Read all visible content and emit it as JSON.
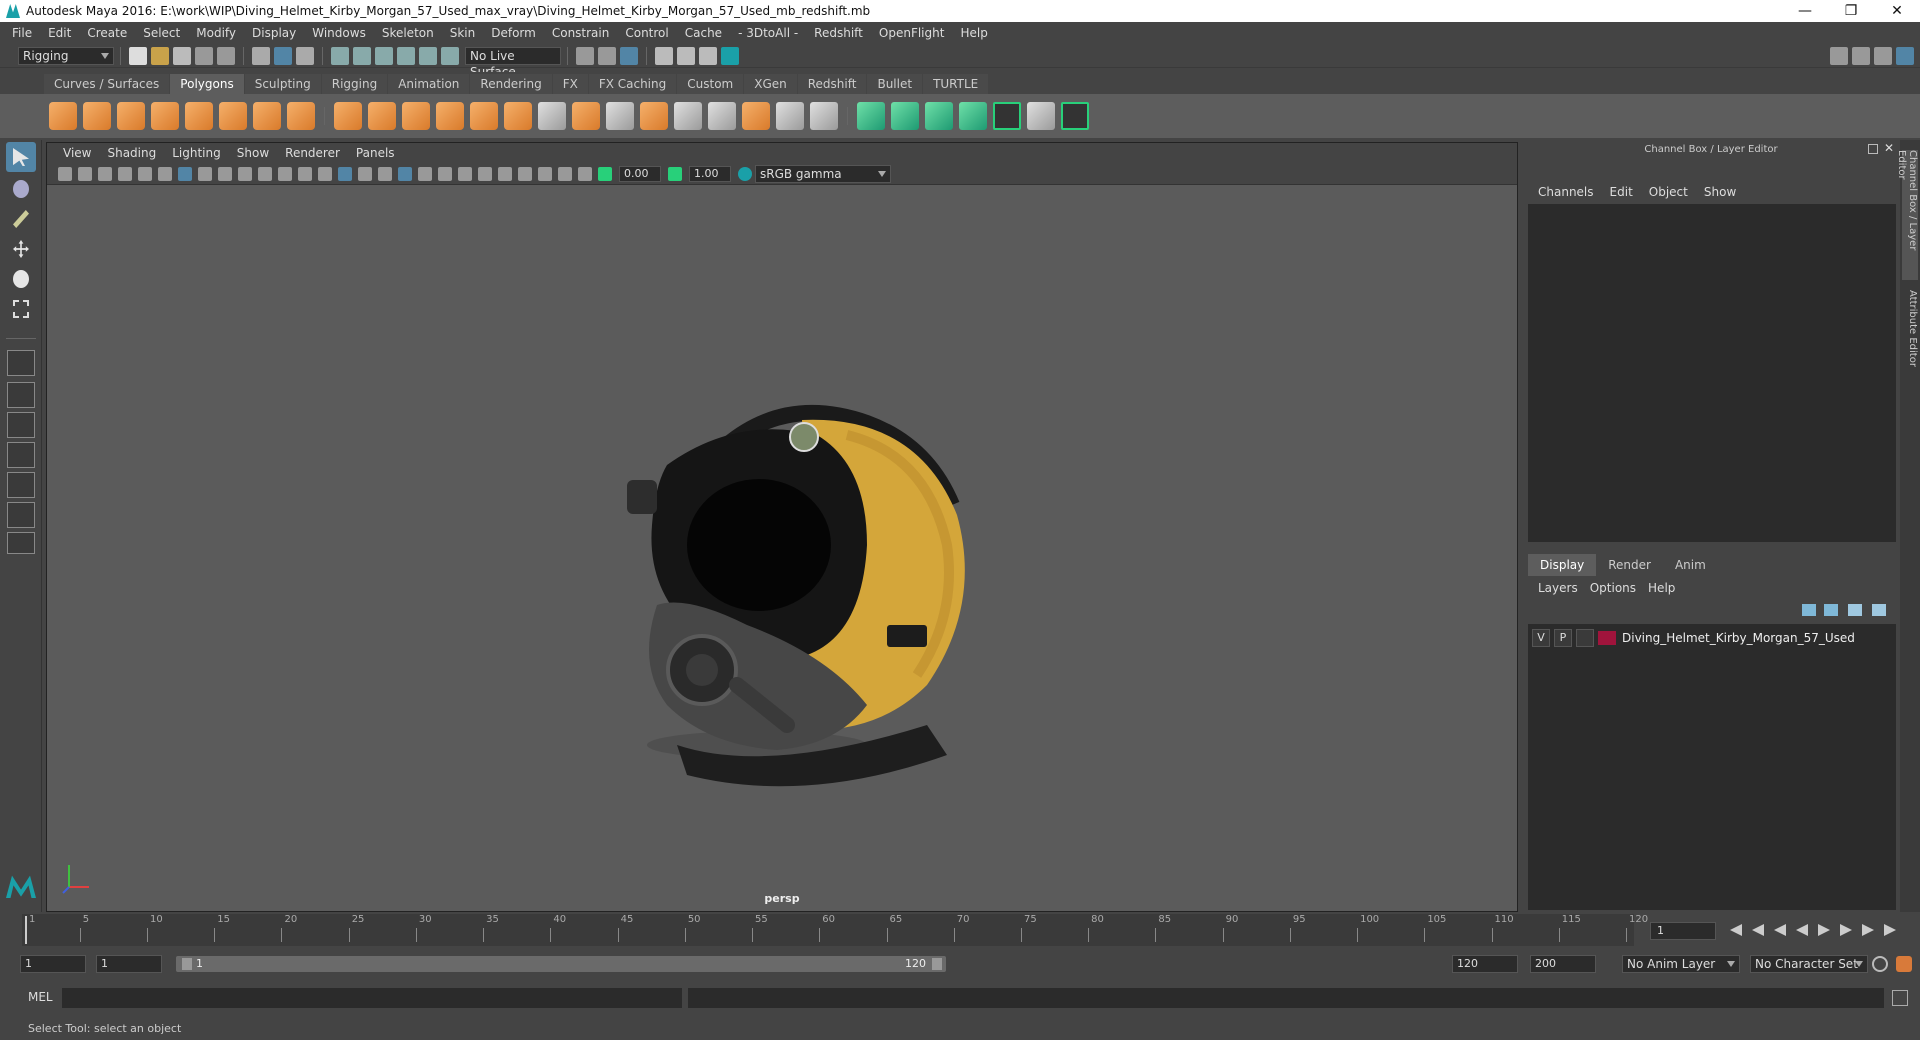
{
  "window": {
    "title": "Autodesk Maya 2016: E:\\work\\WIP\\Diving_Helmet_Kirby_Morgan_57_Used_max_vray\\Diving_Helmet_Kirby_Morgan_57_Used_mb_redshift.mb",
    "minimize": "—",
    "restore": "❐",
    "close": "✕"
  },
  "menu": [
    "File",
    "Edit",
    "Create",
    "Select",
    "Modify",
    "Display",
    "Windows",
    "Skeleton",
    "Skin",
    "Deform",
    "Constrain",
    "Control",
    "Cache",
    "- 3DtoAll -",
    "Redshift",
    "OpenFlight",
    "Help"
  ],
  "status": {
    "menuset": "Rigging",
    "live_surface": "No Live Surface"
  },
  "shelf_tabs": [
    {
      "label": "Curves / Surfaces",
      "active": false
    },
    {
      "label": "Polygons",
      "active": true
    },
    {
      "label": "Sculpting",
      "active": false
    },
    {
      "label": "Rigging",
      "active": false
    },
    {
      "label": "Animation",
      "active": false
    },
    {
      "label": "Rendering",
      "active": false
    },
    {
      "label": "FX",
      "active": false
    },
    {
      "label": "FX Caching",
      "active": false
    },
    {
      "label": "Custom",
      "active": false
    },
    {
      "label": "XGen",
      "active": false
    },
    {
      "label": "Redshift",
      "active": false
    },
    {
      "label": "Bullet",
      "active": false
    },
    {
      "label": "TURTLE",
      "active": false
    }
  ],
  "viewport": {
    "menu": [
      "View",
      "Shading",
      "Lighting",
      "Show",
      "Renderer",
      "Panels"
    ],
    "exposure": "0.00",
    "gamma": "1.00",
    "color_space": "sRGB gamma",
    "camera": "persp"
  },
  "channel_box": {
    "title": "Channel Box / Layer Editor",
    "menu": [
      "Channels",
      "Edit",
      "Object",
      "Show"
    ]
  },
  "layer_editor": {
    "tabs": [
      {
        "label": "Display",
        "active": true
      },
      {
        "label": "Render",
        "active": false
      },
      {
        "label": "Anim",
        "active": false
      }
    ],
    "menu": [
      "Layers",
      "Options",
      "Help"
    ],
    "layers": [
      {
        "v": "V",
        "p": "P",
        "name": "Diving_Helmet_Kirby_Morgan_57_Used",
        "color": "#a0143c"
      }
    ]
  },
  "side_tabs": {
    "channel_box": "Channel Box / Layer Editor",
    "attribute_editor": "Attribute Editor"
  },
  "timeline": {
    "ticks": [
      "1",
      "5",
      "10",
      "15",
      "20",
      "25",
      "30",
      "35",
      "40",
      "45",
      "50",
      "55",
      "60",
      "65",
      "70",
      "75",
      "80",
      "85",
      "90",
      "95",
      "100",
      "105",
      "110",
      "115",
      "120"
    ],
    "current_frame": "1"
  },
  "range": {
    "start": "1",
    "playback_start": "1",
    "slider_start": "1",
    "slider_end": "120",
    "playback_end": "120",
    "end": "200",
    "anim_layer": "No Anim Layer",
    "character_set": "No Character Set"
  },
  "command": {
    "language": "MEL"
  },
  "help_line": "Select Tool: select an object",
  "colors": {
    "helmet_yellow": "#d4a63a",
    "layer_color": "#a0143c",
    "accent_green": "#28d07a",
    "active_tool": "#5285a6"
  }
}
